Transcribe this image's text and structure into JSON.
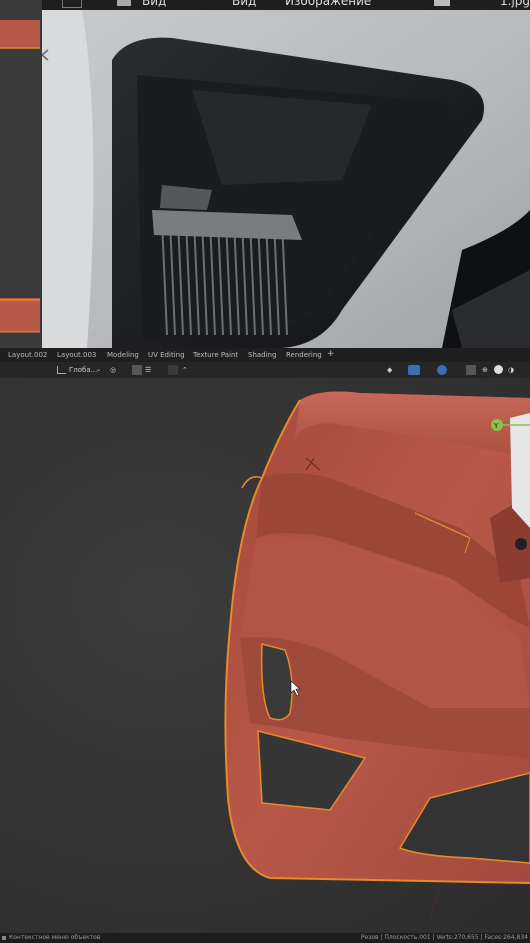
{
  "image_editor": {
    "header": {
      "view_label": "Вид",
      "view_label_2": "Вид",
      "image_menu": "Изображение",
      "image_name": "1.jpg"
    }
  },
  "workspace_tabs": [
    "Layout.002",
    "Layout.003",
    "Modeling",
    "UV Editing",
    "Texture Paint",
    "Shading",
    "Rendering"
  ],
  "add_workspace": "+",
  "viewport_header": {
    "transform_orientation": "Глоба..."
  },
  "gizmo": {
    "y_axis": "Y"
  },
  "status_bar": {
    "left": "Контекстное меню объектов",
    "right": "Резов | Плоскость.001 | Verts:270,655 | Faces:264,834"
  },
  "colors": {
    "model": "#b85848",
    "outline": "#e88a2a",
    "viewport_bg": "#333333"
  }
}
